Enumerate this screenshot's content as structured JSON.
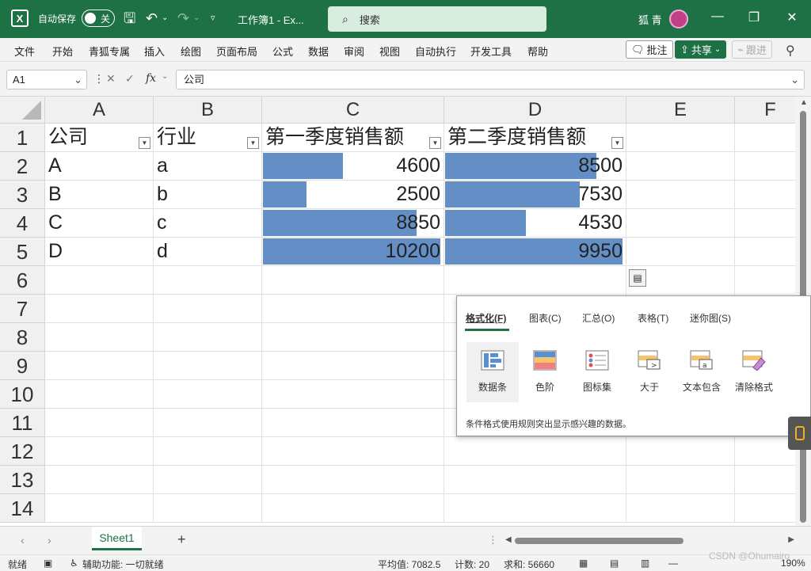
{
  "titlebar": {
    "logo": "X",
    "autosave_label": "自动保存",
    "autosave_state": "关",
    "doc_title": "工作簿1 - Ex...",
    "search_placeholder": "搜索",
    "user_name": "狐 青"
  },
  "menu": {
    "items": [
      "文件",
      "开始",
      "青狐专属",
      "插入",
      "绘图",
      "页面布局",
      "公式",
      "数据",
      "审阅",
      "视图",
      "自动执行",
      "开发工具",
      "帮助"
    ],
    "comments_label": "批注",
    "share_label": "共享",
    "follow_label": "跟进"
  },
  "formula": {
    "name_box": "A1",
    "content": "公司"
  },
  "grid": {
    "columns": [
      "A",
      "B",
      "C",
      "D",
      "E",
      "F"
    ],
    "rows": [
      "1",
      "2",
      "3",
      "4",
      "5",
      "6",
      "7",
      "8",
      "9",
      "10",
      "11",
      "12",
      "13",
      "14"
    ],
    "header_row": [
      "公司",
      "行业",
      "第一季度销售额",
      "第二季度销售额"
    ],
    "data_rows": [
      {
        "company": "A",
        "industry": "a",
        "q1": "4600",
        "q2": "8500"
      },
      {
        "company": "B",
        "industry": "b",
        "q1": "2500",
        "q2": "7530"
      },
      {
        "company": "C",
        "industry": "c",
        "q1": "8850",
        "q2": "4530"
      },
      {
        "company": "D",
        "industry": "d",
        "q1": "10200",
        "q2": "9950"
      }
    ],
    "q1_bar_fractions": [
      0.451,
      0.245,
      0.868,
      1.0
    ],
    "q2_bar_fractions": [
      0.854,
      0.757,
      0.455,
      1.0
    ],
    "databar_color": "#638ec6"
  },
  "quick_analysis": {
    "tabs": [
      "格式化(F)",
      "图表(C)",
      "汇总(O)",
      "表格(T)",
      "迷你图(S)"
    ],
    "tools": [
      "数据条",
      "色阶",
      "图标集",
      "大于",
      "文本包含",
      "清除格式"
    ],
    "description": "条件格式使用规则突出显示感兴趣的数据。"
  },
  "sheets": {
    "tabs": [
      "Sheet1"
    ],
    "add": "+"
  },
  "status": {
    "ready": "就绪",
    "accessibility": "辅助功能: 一切就绪",
    "average": "平均值: 7082.5",
    "count": "计数: 20",
    "sum": "求和: 56660",
    "zoom": "190%",
    "watermark": "CSDN @Ohumairo"
  },
  "colors": {
    "accent": "#1e7145",
    "databar": "#638ec6"
  }
}
